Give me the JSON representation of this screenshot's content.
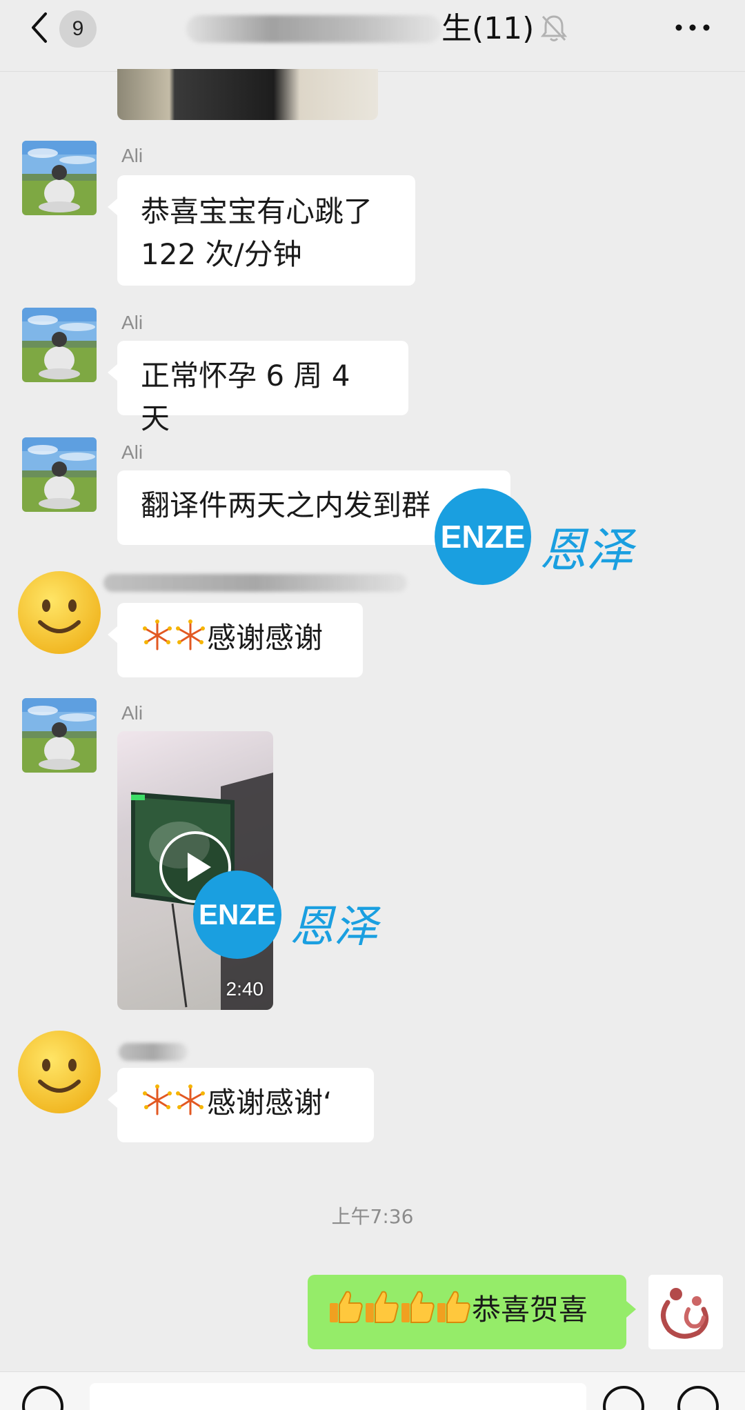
{
  "header": {
    "unread_count": "9",
    "title_suffix": "生(11)",
    "icons": {
      "back": "chevron-left-icon",
      "mute": "bell-off-icon",
      "more": "more-icon"
    }
  },
  "messages": [
    {
      "sender": "Ali",
      "lines": [
        "恭喜宝宝有心跳了",
        "122 次/分钟"
      ]
    },
    {
      "sender": "Ali",
      "lines": [
        "正常怀孕 6 周 4 天"
      ]
    },
    {
      "sender": "Ali",
      "lines": [
        "翻译件两天之内发到群"
      ]
    },
    {
      "sender": "",
      "text": "感谢感谢"
    },
    {
      "sender": "Ali",
      "video_duration": "2:40"
    },
    {
      "sender": "",
      "text": "感谢感谢‘"
    }
  ],
  "timestamp": "上午7:36",
  "my_message": {
    "text": "恭喜贺喜"
  },
  "watermark": {
    "latin": "ENZE",
    "chinese": "恩泽"
  },
  "colors": {
    "background": "#ededed",
    "bubble_in": "#ffffff",
    "bubble_out": "#95ec69",
    "watermark_blue": "#1a9fe0"
  }
}
